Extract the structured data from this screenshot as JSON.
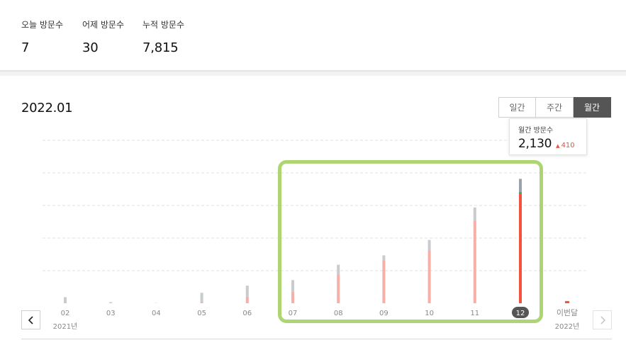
{
  "stats": {
    "today": {
      "label": "오늘 방문수",
      "value": "7"
    },
    "yesterday": {
      "label": "어제 방문수",
      "value": "30"
    },
    "total": {
      "label": "누적 방문수",
      "value": "7,815"
    }
  },
  "period_title": "2022.01",
  "toggle": {
    "daily": "일간",
    "weekly": "주간",
    "monthly": "월간",
    "active": "monthly"
  },
  "tooltip": {
    "label": "월간 방문수",
    "value": "2,130",
    "change_arrow": "▲",
    "change": "410"
  },
  "colors": {
    "accent_red": "#f4523f",
    "light_red": "#f6b0a8",
    "grey_bar": "#c9cbce",
    "dark_grey_bar": "#9aa2ac",
    "highlight_green": "#9fcf5a"
  },
  "chart_data": {
    "type": "bar",
    "categories": [
      "02",
      "03",
      "04",
      "05",
      "06",
      "07",
      "08",
      "09",
      "10",
      "11",
      "12",
      "이번달"
    ],
    "year_labels": [
      {
        "category": "02",
        "text": "2021년"
      },
      {
        "category": "이번달",
        "text": "2022년"
      }
    ],
    "selected": "12",
    "series": [
      {
        "values": [
          0,
          0,
          2,
          10,
          60,
          105,
          260,
          390,
          480,
          750,
          1000,
          20
        ]
      },
      {
        "values": [
          55,
          10,
          0,
          85,
          100,
          105,
          90,
          45,
          95,
          120,
          130,
          0
        ]
      }
    ],
    "ylim": [
      0,
      1300
    ],
    "grid": true
  },
  "nav": {
    "prev_icon": "chevron-left-icon",
    "next_icon": "chevron-right-icon"
  }
}
